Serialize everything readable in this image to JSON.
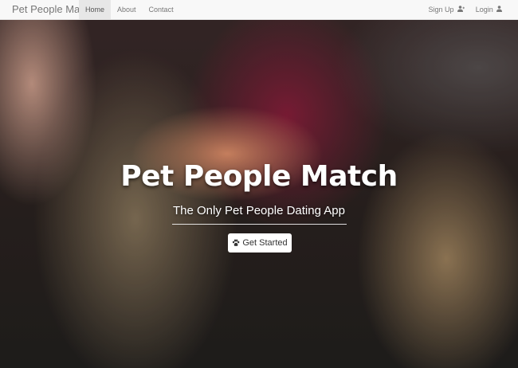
{
  "navbar": {
    "brand": "Pet People Match",
    "left_items": [
      {
        "label": "Home",
        "active": true
      },
      {
        "label": "About",
        "active": false
      },
      {
        "label": "Contact",
        "active": false
      }
    ],
    "right_items": [
      {
        "label": "Sign Up",
        "icon": "user-plus-icon"
      },
      {
        "label": "Login",
        "icon": "user-icon"
      }
    ]
  },
  "hero": {
    "title": "Pet People Match",
    "subtitle": "The Only Pet People Dating App",
    "cta_label": "Get Started",
    "cta_icon": "paw-icon"
  }
}
